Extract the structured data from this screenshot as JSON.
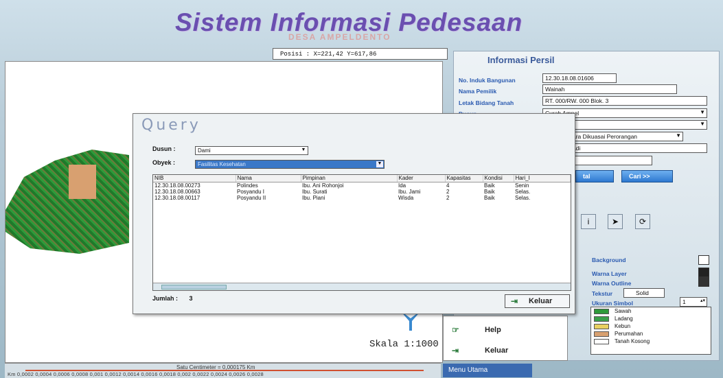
{
  "header": {
    "title": "Sistem Informasi Pedesaan",
    "subtitle": "DESA AMPELDENTO",
    "posisi": "Posisi : X=221,42  Y=617,86"
  },
  "map": {
    "scale_label": "Skala 1:1000"
  },
  "scalebar": {
    "cm_label": "Satu Centimeter = 0,000175 Km",
    "ticks": "Km  0,0002  0,0004  0,0006  0,0008  0,001  0,0012  0,0014  0,0016  0,0018  0,002  0,0022  0,0024  0,0026  0,0028"
  },
  "info_panel": {
    "title": "Informasi Persil",
    "fields": [
      {
        "label": "No. Induk Bangunan",
        "value": "12.30.18.08.01606"
      },
      {
        "label": "Nama Pemilik",
        "value": "Wainah"
      },
      {
        "label": "Letak Bidang Tanah",
        "value": "RT. 000/RW. 000 Blok. 3"
      },
      {
        "label": "Dusun",
        "value": "Curah Ampel"
      }
    ],
    "status_value": "ara Dikuasai Perorangan",
    "partial_value": "adi",
    "btn_total": "tal",
    "btn_cari": "Cari >>"
  },
  "style_panel": {
    "background_label": "Background",
    "warna_layer_label": "Warna Layer",
    "warna_outline_label": "Warna Outline",
    "tekstur_label": "Tekstur",
    "tekstur_value": "Solid",
    "ukuran_label": "Ukuran Simbol",
    "ukuran_value": "1",
    "colors": {
      "background": "#ffffff",
      "layer": "#222222",
      "outline": "#333333"
    },
    "legend": [
      {
        "label": "Sawah",
        "color": "#2e9a3a"
      },
      {
        "label": "Ladang",
        "color": "#3aa04a"
      },
      {
        "label": "Kebun",
        "color": "#e8d060"
      },
      {
        "label": "Perumahan",
        "color": "#d8a070"
      },
      {
        "label": "Tanah Kosong",
        "color": "#ffffff"
      }
    ]
  },
  "menu": {
    "help": "Help",
    "keluar": "Keluar",
    "menu_utama": "Menu Utama"
  },
  "query_dialog": {
    "title": "Query",
    "dusun_label": "Dusun :",
    "dusun_value": "Dami",
    "obyek_label": "Obyek :",
    "obyek_value": "Fasilitas Kesehatan",
    "columns": [
      "NIB",
      "Nama",
      "Pimpinan",
      "Kader",
      "Kapasitas",
      "Kondisi",
      "Hari_I"
    ],
    "rows": [
      [
        "12.30.18.08.00273",
        "Polindes",
        "Ibu. Ani Rohonjoi",
        "Ida",
        "4",
        "Baik",
        "Senin"
      ],
      [
        "12.30.18.08.00663",
        "Posyandu I",
        "Ibu. Surati",
        "Ibu. Jami",
        "2",
        "Baik",
        "Selas."
      ],
      [
        "12.30.18.08.00117",
        "Posyandu II",
        "Ibu. Piani",
        "Wisda",
        "2",
        "Baik",
        "Selas."
      ]
    ],
    "jumlah_label": "Jumlah :",
    "jumlah_value": "3",
    "keluar": "Keluar"
  }
}
